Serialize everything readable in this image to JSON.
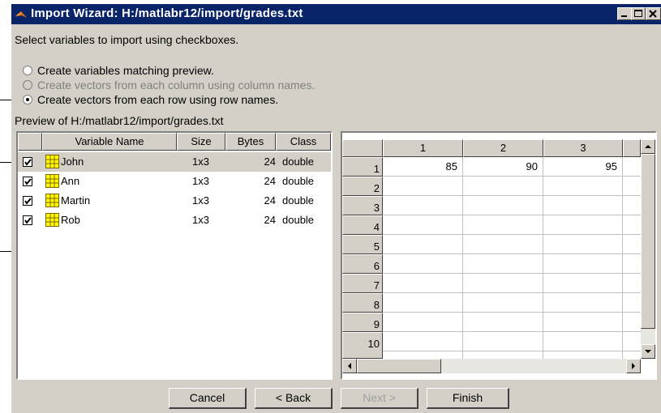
{
  "window": {
    "title": "Import Wizard: H:/matlabr12/import/grades.txt",
    "controls": [
      "minimize",
      "maximize",
      "close"
    ]
  },
  "instructions": "Select variables to import using checkboxes.",
  "options": [
    {
      "label": "Create variables matching preview.",
      "selected": false,
      "enabled": true
    },
    {
      "label": "Create vectors from each column using column names.",
      "selected": false,
      "enabled": false
    },
    {
      "label": "Create vectors from each row using row names.",
      "selected": true,
      "enabled": true
    }
  ],
  "preview_label": "Preview of H:/matlabr12/import/grades.txt",
  "variables": {
    "headers": {
      "name": "Variable Name",
      "size": "Size",
      "bytes": "Bytes",
      "class": "Class"
    },
    "rows": [
      {
        "checked": true,
        "name": "John",
        "size": "1x3",
        "bytes": "24",
        "class": "double",
        "selected": true
      },
      {
        "checked": true,
        "name": "Ann",
        "size": "1x3",
        "bytes": "24",
        "class": "double",
        "selected": false
      },
      {
        "checked": true,
        "name": "Martin",
        "size": "1x3",
        "bytes": "24",
        "class": "double",
        "selected": false
      },
      {
        "checked": true,
        "name": "Rob",
        "size": "1x3",
        "bytes": "24",
        "class": "double",
        "selected": false
      }
    ]
  },
  "grid": {
    "columns": [
      "1",
      "2",
      "3"
    ],
    "row_labels": [
      "1",
      "2",
      "3",
      "4",
      "5",
      "6",
      "7",
      "8",
      "9",
      "10"
    ],
    "first_row": [
      "85",
      "90",
      "95"
    ]
  },
  "buttons": {
    "cancel": "Cancel",
    "back": "< Back",
    "next": "Next >",
    "finish": "Finish"
  },
  "colors": {
    "titlebar": "#0a246a",
    "face": "#d4d0c8",
    "icon_yellow": "#ffff00"
  }
}
